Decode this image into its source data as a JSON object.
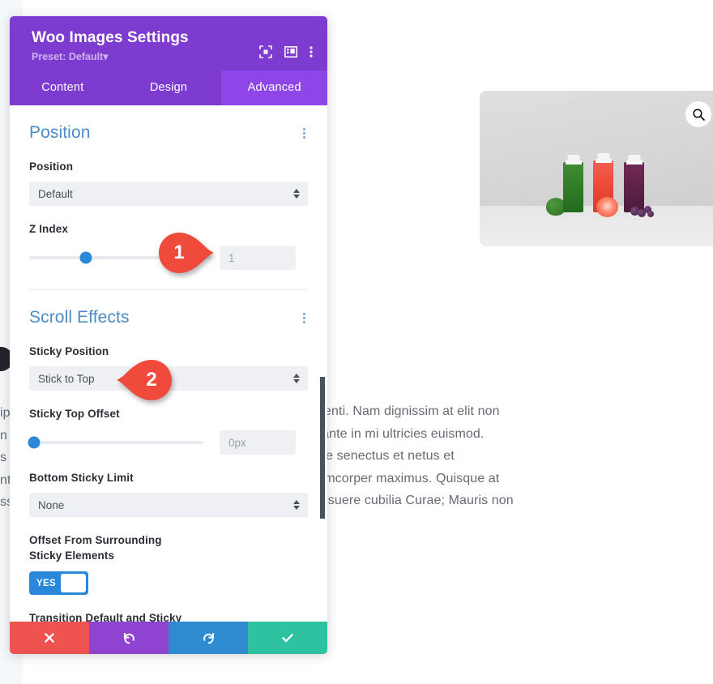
{
  "modal": {
    "title": "Woo Images Settings",
    "preset": "Preset: Default",
    "preset_caret": "▾",
    "header_icons": [
      {
        "name": "fullscreen-icon",
        "label": "Expand"
      },
      {
        "name": "layout-icon",
        "label": "Layout"
      },
      {
        "name": "more-options-icon",
        "label": "More"
      }
    ],
    "tabs": [
      {
        "label": "Content",
        "active": false
      },
      {
        "label": "Design",
        "active": false
      },
      {
        "label": "Advanced",
        "active": true
      }
    ],
    "footer": [
      {
        "name": "cancel-button",
        "glyph": "✖",
        "label": "Cancel"
      },
      {
        "name": "undo-button",
        "glyph": "↺",
        "label": "Undo"
      },
      {
        "name": "redo-button",
        "glyph": "↻",
        "label": "Redo"
      },
      {
        "name": "save-button",
        "glyph": "✔",
        "label": "Save"
      }
    ]
  },
  "position_section": {
    "title": "Position",
    "position_label": "Position",
    "position_value": "Default",
    "zindex_label": "Z Index",
    "zindex_value": "1"
  },
  "scroll_section": {
    "title": "Scroll Effects",
    "sticky_position_label": "Sticky Position",
    "sticky_position_value": "Stick to Top",
    "sticky_top_offset_label": "Sticky Top Offset",
    "sticky_top_offset_value": "0px",
    "bottom_sticky_limit_label": "Bottom Sticky Limit",
    "bottom_sticky_limit_value": "None",
    "offset_surrounding_label": "Offset From Surrounding Sticky Elements",
    "offset_surrounding_toggle": "YES",
    "transition_label": "Transition Default and Sticky"
  },
  "callouts": [
    {
      "number": "1",
      "target": "z-index-value"
    },
    {
      "number": "2",
      "target": "sticky-position-select"
    }
  ],
  "page": {
    "body_text": "spendisse potenti. Nam dignissim at elit non as commodo ante in mi ultricies euismod. t morbi tristique senectus et netus et tus a nibh ullamcorper maximus. Quisque at s et ultrices posuere cubilia Curae; Mauris non",
    "body_lines": [
      "spendisse potenti. Nam dignissim at elit non",
      "as commodo ante in mi ultricies euismod.",
      "t morbi tristique senectus et netus et",
      "tus a nibh ullamcorper maximus. Quisque at",
      "s et ultrices posuere cubilia Curae; Mauris non"
    ],
    "left_fragments": [
      "ip",
      "n",
      "s i",
      "nt",
      "ss"
    ],
    "product_zoom_icon": "search-icon"
  },
  "colors": {
    "header_purple": "#7e3bd0",
    "tab_active_purple": "#8f46e8",
    "section_title_blue": "#4c8bc6",
    "accent_blue": "#2b87da",
    "callout_red": "#ef4a3c",
    "footer_cancel": "#ef5350",
    "footer_undo": "#8e44d0",
    "footer_redo": "#2e8bd0",
    "footer_save": "#2ec2a0"
  }
}
